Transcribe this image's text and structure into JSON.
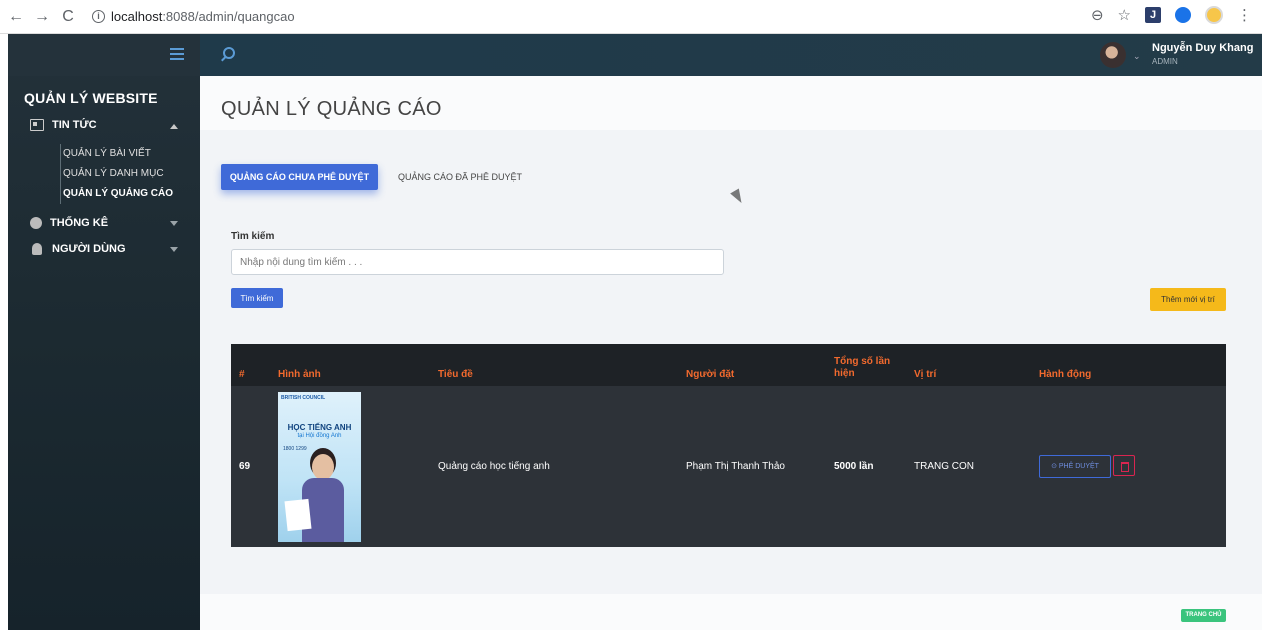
{
  "browser": {
    "url_host": "localhost",
    "url_path": ":8088/admin/quangcao"
  },
  "sidebar": {
    "brand": "QUẢN LÝ WEBSITE",
    "items": [
      {
        "label": "TIN TỨC",
        "icon": "newspaper-icon",
        "expanded": true
      },
      {
        "label": "THỐNG KÊ",
        "icon": "pie-chart-icon",
        "expanded": false
      },
      {
        "label": "NGƯỜI DÙNG",
        "icon": "user-icon",
        "expanded": false
      }
    ],
    "submenu": [
      {
        "label": "QUẢN LÝ BÀI VIẾT"
      },
      {
        "label": "QUẢN LÝ DANH MỤC"
      },
      {
        "label": "QUẢN LÝ QUẢNG CÁO",
        "active": true
      }
    ]
  },
  "header": {
    "user_name": "Nguyễn Duy Khang",
    "user_role": "ADMIN"
  },
  "main": {
    "title": "QUẢN LÝ QUẢNG CÁO",
    "tabs": [
      {
        "label": "QUẢNG CÁO CHƯA PHÊ DUYỆT",
        "active": true
      },
      {
        "label": "QUẢNG CÁO ĐÃ PHÊ DUYỆT",
        "active": false
      }
    ],
    "search_label": "Tìm kiếm",
    "search_placeholder": "Nhập nội dung tìm kiếm . . .",
    "search_button": "Tìm kiếm",
    "add_button": "Thêm mới vị trí",
    "table": {
      "headers": [
        "#",
        "Hình ảnh",
        "Tiêu đề",
        "Người đặt",
        "Tổng số lần hiện",
        "Vị trí",
        "Hành động"
      ],
      "rows": [
        {
          "id": "69",
          "title": "Quảng cáo học tiếng anh",
          "owner": "Phạm Thị Thanh Thảo",
          "views": "5000 lần",
          "position": "TRANG CON",
          "approve_label": "PHÊ DUYỆT",
          "ad_image": {
            "logo": "BRITISH COUNCIL",
            "headline": "HỌC TIẾNG ANH",
            "subline": "tại Hội đồng Anh",
            "phone": "1800 1299"
          }
        }
      ]
    },
    "home_badge": "TRANG CHỦ"
  },
  "colors": {
    "primary": "#3f6ad8",
    "warning": "#f5b91a",
    "success": "#3ac47d",
    "danger": "#d92550",
    "table_header_text": "#f26a2e"
  }
}
